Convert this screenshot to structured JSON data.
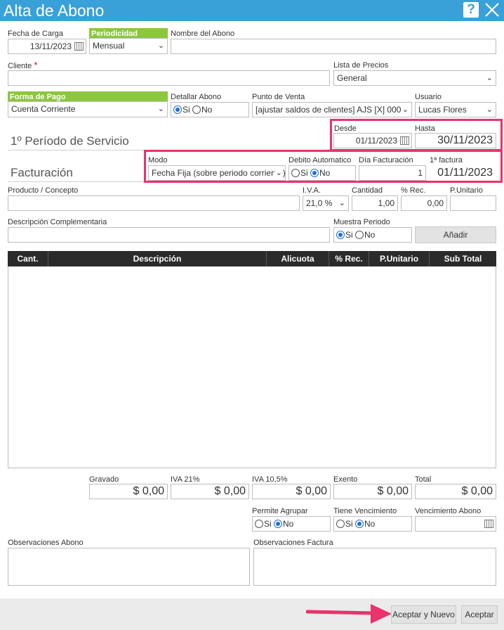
{
  "window": {
    "title": "Alta de Abono"
  },
  "header_row": {
    "fecha_carga": {
      "label": "Fecha de Carga",
      "value": "13/11/2023"
    },
    "periodicidad": {
      "label": "Periodicidad",
      "value": "Mensual"
    },
    "nombre": {
      "label": "Nombre del Abono",
      "value": ""
    }
  },
  "cliente": {
    "label": "Cliente",
    "required_mark": "*",
    "value": ""
  },
  "lista_precios": {
    "label": "Lista de Precios",
    "value": "General"
  },
  "forma_pago": {
    "label": "Forma de Pago",
    "value": "Cuenta Corriente"
  },
  "detallar": {
    "label": "Detallar Abono",
    "options": [
      "Si",
      "No"
    ],
    "selected": "Si"
  },
  "punto_venta": {
    "label": "Punto de Venta",
    "value": "[ajustar saldos de clientes] AJS [X] 000"
  },
  "usuario": {
    "label": "Usuario",
    "value": "Lucas Flores"
  },
  "periodo": {
    "title": "1º Período de Servicio",
    "desde": {
      "label": "Desde",
      "value": "01/11/2023"
    },
    "hasta": {
      "label": "Hasta",
      "value": "30/11/2023"
    }
  },
  "facturacion": {
    "title": "Facturación",
    "modo": {
      "label": "Modo",
      "value": "Fecha Fija (sobre periodo corriente)"
    },
    "debito": {
      "label": "Debito Automatico",
      "options": [
        "Si",
        "No"
      ],
      "selected": "No"
    },
    "dia": {
      "label": "Día Facturación",
      "value": "1"
    },
    "primera": {
      "label": "1ª factura",
      "value": "01/11/2023"
    }
  },
  "item": {
    "producto": {
      "label": "Producto / Concepto",
      "value": ""
    },
    "iva": {
      "label": "I.V.A.",
      "value": "21,0 %"
    },
    "cantidad": {
      "label": "Cantidad",
      "value": "1,00"
    },
    "rec": {
      "label": "% Rec.",
      "value": "0,00"
    },
    "punitario": {
      "label": "P.Unitario",
      "value": ""
    },
    "descripcion": {
      "label": "Descripción Complementaria",
      "value": ""
    },
    "muestra": {
      "label": "Muestra Periodo",
      "options": [
        "Si",
        "No"
      ],
      "selected": "Si"
    },
    "add_label": "Añadir"
  },
  "grid": {
    "columns": [
      "Cant.",
      "Descripción",
      "Alicuota",
      "% Rec.",
      "P.Unitario",
      "Sub Total"
    ]
  },
  "totals": [
    {
      "label": "Gravado",
      "value": "$ 0,00"
    },
    {
      "label": "IVA 21%",
      "value": "$ 0,00"
    },
    {
      "label": "IVA 10,5%",
      "value": "$ 0,00"
    },
    {
      "label": "Exento",
      "value": "$ 0,00"
    },
    {
      "label": "Total",
      "value": "$ 0,00"
    }
  ],
  "agrupar": {
    "label": "Permite Agrupar",
    "options": [
      "Si",
      "No"
    ],
    "selected": "No"
  },
  "vencimiento": {
    "label": "Tiene Vencimiento",
    "options": [
      "Si",
      "No"
    ],
    "selected": "No"
  },
  "venc_abono": {
    "label": "Vencimiento Abono",
    "value": ""
  },
  "obs_abono": {
    "label": "Observaciones Abono"
  },
  "obs_factura": {
    "label": "Observaciones Factura"
  },
  "footer": {
    "accept_new_label": "Aceptar y Nuevo",
    "accept_label": "Aceptar"
  },
  "colors": {
    "titlebar": "#3aa0d8",
    "green": "#8dc63f",
    "highlight": "#e8336b",
    "grid_header": "#2b2b2b"
  }
}
